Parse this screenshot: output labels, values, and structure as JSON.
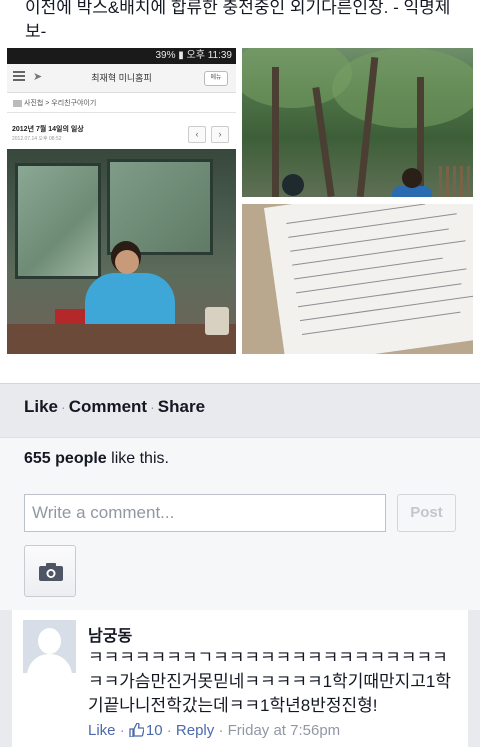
{
  "post": {
    "caption": "이전에 박스&배치에 합류한 충전중인 외기다른인장. - 익명제보-",
    "photos": {
      "screenshot": {
        "status_time": "39% ▮ 오후 11:39",
        "app_title": "최재혁 미니홈피",
        "menu_label": "메뉴",
        "breadcrumb": "사진첩 > 우리친구야이기",
        "album_date": "2012년 7월 14일의 일상",
        "album_sub": "2012.07.14 오후 08:52",
        "prev_arrow": "‹",
        "next_arrow": "›"
      }
    }
  },
  "actions": {
    "like": "Like",
    "comment": "Comment",
    "share": "Share",
    "separator": "·"
  },
  "likes": {
    "count": "655 people",
    "suffix": " like this."
  },
  "composer": {
    "placeholder": "Write a comment...",
    "post_label": "Post",
    "camera_icon": "camera-icon"
  },
  "comment": {
    "author": "남궁동",
    "text": "ㅋㅋㅋㅋㅋㅋㅋㄱㅋㅋㅋㅋㅋㅋㅋㅋㅋㅋㅋㅋㅋㅋㅋㅋㅋ가슴만진거못믿네ㅋㅋㅋㅋㅋ1학기때만지고1학기끝나니전학갔는데ㅋㅋ1학년8반정진형!",
    "like_label": "Like",
    "like_count": "10",
    "reply_label": "Reply",
    "timestamp": "Friday at 7:56pm",
    "separator": "·"
  },
  "colors": {
    "background": "#e9eaed",
    "link": "#4b6aab",
    "muted": "#9197a3",
    "text": "#141823"
  }
}
